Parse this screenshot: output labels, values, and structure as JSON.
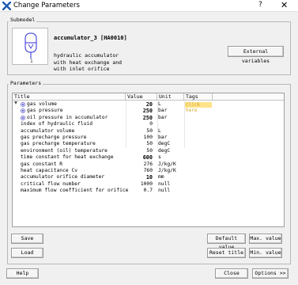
{
  "window": {
    "title": "Change Parameters",
    "help_glyph": "?",
    "close_glyph": "✕"
  },
  "colors": {
    "accent": "#1e5bb0",
    "tag_highlight": "#ffe38a",
    "tag_text": "#d0a530"
  },
  "submodel": {
    "group_label": "Submodel",
    "name": "accumulator_3 [HA0010]",
    "description": [
      "hydraulic accumulator",
      "with heat exchange and",
      "with inlet orifice"
    ],
    "symbol_port": "1",
    "external_variables_label": "External variables"
  },
  "parameters": {
    "group_label": "Parameters",
    "columns": [
      "Title",
      "Value",
      "Unit",
      "Tags"
    ],
    "rows": [
      {
        "title": "gas volume",
        "value": "20",
        "unit": "L",
        "tags": "Click here",
        "port": true,
        "bold": true
      },
      {
        "title": "gas pressure",
        "value": "250",
        "unit": "bar",
        "tags": "",
        "port": true,
        "bold": true
      },
      {
        "title": "oil pressure in accumulator",
        "value": "250",
        "unit": "bar",
        "tags": "",
        "port": true,
        "bold": true
      },
      {
        "title": "index of hydraulic fluid",
        "value": "0",
        "unit": "",
        "tags": "",
        "port": false,
        "bold": false
      },
      {
        "title": "accumulator volume",
        "value": "50",
        "unit": "L",
        "tags": "",
        "port": false,
        "bold": false
      },
      {
        "title": "gas precharge pressure",
        "value": "100",
        "unit": "bar",
        "tags": "",
        "port": false,
        "bold": false
      },
      {
        "title": "gas precharge temperature",
        "value": "50",
        "unit": "degC",
        "tags": "",
        "port": false,
        "bold": false
      },
      {
        "title": "environment (oil) temperature",
        "value": "50",
        "unit": "degC",
        "tags": "",
        "port": false,
        "bold": false
      },
      {
        "title": "time constant for heat exchange",
        "value": "600",
        "unit": "s",
        "tags": "",
        "port": false,
        "bold": true
      },
      {
        "title": "gas constant R",
        "value": "276",
        "unit": "J/kg/K",
        "tags": "",
        "port": false,
        "bold": false
      },
      {
        "title": "heat capacitance Cv",
        "value": "760",
        "unit": "J/kg/K",
        "tags": "",
        "port": false,
        "bold": false
      },
      {
        "title": "accumulator orifice diameter",
        "value": "10",
        "unit": "mm",
        "tags": "",
        "port": false,
        "bold": true
      },
      {
        "title": "critical flow number",
        "value": "1000",
        "unit": "null",
        "tags": "",
        "port": false,
        "bold": false
      },
      {
        "title": "maximum flow coefficient for orifice",
        "value": "0.7",
        "unit": "null",
        "tags": "",
        "port": false,
        "bold": false
      }
    ]
  },
  "buttons": {
    "save": "Save",
    "load": "Load",
    "default_value": "Default value",
    "max_value": "Max. value",
    "reset_title": "Reset title",
    "min_value": "Min. value",
    "help": "Help",
    "close": "Close",
    "options": "Options >>"
  }
}
